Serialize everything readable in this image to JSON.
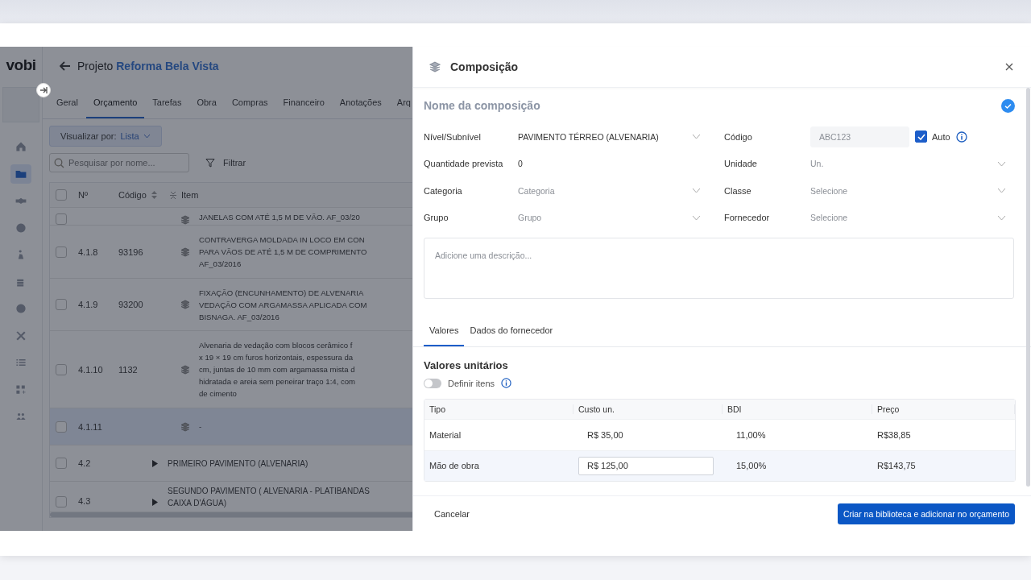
{
  "app": {
    "logo": "vobi",
    "back_label": "Projeto",
    "project_name": "Reforma Bela Vista",
    "sidebar": [
      {
        "selected": false
      },
      {
        "selected": true
      },
      {
        "selected": false
      },
      {
        "selected": false
      },
      {
        "selected": false
      },
      {
        "selected": false
      },
      {
        "selected": false
      },
      {
        "selected": false
      },
      {
        "selected": false
      },
      {
        "selected": false
      },
      {
        "selected": false
      }
    ],
    "tabs": [
      {
        "label": "Geral",
        "selected": false
      },
      {
        "label": "Orçamento",
        "selected": true
      },
      {
        "label": "Tarefas",
        "selected": false
      },
      {
        "label": "Obra",
        "selected": false
      },
      {
        "label": "Compras",
        "selected": false
      },
      {
        "label": "Financeiro",
        "selected": false
      },
      {
        "label": "Anotações",
        "selected": false
      },
      {
        "label": "Arq",
        "selected": false
      }
    ],
    "view_by": {
      "label": "Visualizar por:",
      "value": "Lista"
    },
    "search": {
      "placeholder": "Pesquisar por nome..."
    },
    "filter": "Filtrar",
    "table": {
      "columns": [
        "Nº",
        "Código",
        "Item"
      ],
      "all_checked": false,
      "rows": [
        {
          "kind": "item",
          "number": "",
          "code": "",
          "lines": [
            "JANELAS COM ATÉ 1,5 M DE VÃO. AF_03/20"
          ],
          "selected": false,
          "checked": false
        },
        {
          "kind": "item",
          "number": "4.1.8",
          "code": "93196",
          "lines": [
            "CONTRAVERGA MOLDADA IN LOCO EM CON",
            "PARA VÃOS DE ATÉ 1,5 M DE COMPRIMENTO",
            "AF_03/2016"
          ],
          "selected": false,
          "checked": false
        },
        {
          "kind": "item",
          "number": "4.1.9",
          "code": "93200",
          "lines": [
            "FIXAÇÃO (ENCUNHAMENTO) DE ALVENARIA",
            "VEDAÇÃO COM ARGAMASSA APLICADA COM",
            "BISNAGA. AF_03/2016"
          ],
          "selected": false,
          "checked": false
        },
        {
          "kind": "item",
          "number": "4.1.10",
          "code": "1132",
          "lines": [
            "Alvenaria de vedação com blocos cerâmico f",
            "x 19 × 19 cm furos horizontais, espessura da",
            "cm, juntas de 10 mm com argamassa mista d",
            "hidratada e areia sem peneirar traço 1:4, com",
            "de cimento"
          ],
          "selected": false,
          "checked": false
        },
        {
          "kind": "item",
          "number": "4.1.11",
          "code": "",
          "lines": [
            "-"
          ],
          "selected": true,
          "checked": false
        },
        {
          "kind": "group",
          "number": "4.2",
          "code": "",
          "lines": [
            "PRIMEIRO PAVIMENTO (ALVENARIA)"
          ],
          "selected": false,
          "checked": false
        },
        {
          "kind": "group",
          "number": "4.3",
          "code": "",
          "lines": [
            "SEGUNDO PAVIMENTO ( ALVENARIA - PLATIBANDAS",
            "CAIXA D'ÁGUA)"
          ],
          "selected": false,
          "checked": false
        }
      ]
    }
  },
  "drawer": {
    "title": "Composição",
    "name_placeholder": "Nome da composição",
    "left_fields": [
      {
        "label": "Nível/Subnível",
        "kind": "select",
        "value": "PAVIMENTO TÉRREO (ALVENARIA)"
      },
      {
        "label": "Quantidade prevista",
        "kind": "text",
        "value": "0"
      },
      {
        "label": "Categoria",
        "kind": "select",
        "placeholder": "Categoria"
      },
      {
        "label": "Grupo",
        "kind": "select",
        "placeholder": "Grupo"
      }
    ],
    "right_fields": [
      {
        "label": "Código",
        "kind": "code",
        "value": "ABC123",
        "disabled": true,
        "auto_label": "Auto",
        "auto_checked": true
      },
      {
        "label": "Unidade",
        "kind": "select",
        "placeholder": "Un."
      },
      {
        "label": "Classe",
        "kind": "select",
        "placeholder": "Selecione"
      },
      {
        "label": "Fornecedor",
        "kind": "select",
        "placeholder": "Selecione"
      }
    ],
    "description_placeholder": "Adicione uma descrição...",
    "tabs": [
      {
        "label": "Valores",
        "selected": true
      },
      {
        "label": "Dados do fornecedor",
        "selected": false
      }
    ],
    "section_title": "Valores unitários",
    "define_items": {
      "label": "Definir itens",
      "on": false
    },
    "values_table": {
      "columns": [
        "Tipo",
        "Custo un.",
        "BDI",
        "Preço"
      ],
      "rows": [
        {
          "type": "Material",
          "cost": "R$ 35,00",
          "bdi": "11,00%",
          "price": "R$38,85",
          "editing": false
        },
        {
          "type": "Mão de obra",
          "cost": "R$ 125,00",
          "bdi": "15,00%",
          "price": "R$143,75",
          "editing": true
        }
      ]
    },
    "cancel": "Cancelar",
    "submit": "Criar na biblioteca e adicionar no orçamento"
  }
}
